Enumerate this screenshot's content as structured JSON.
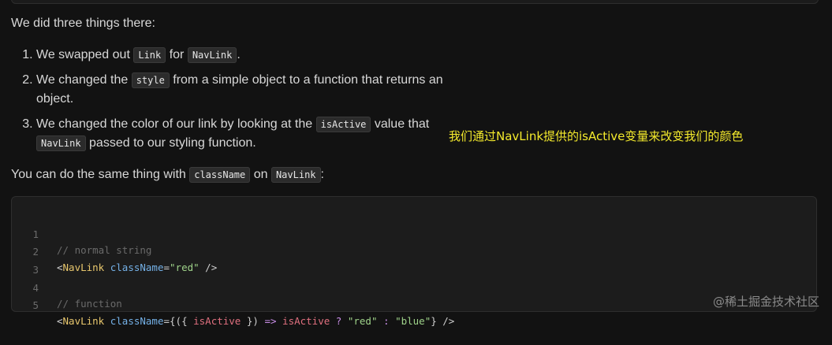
{
  "intro": "We did three things there:",
  "changes": [
    {
      "num": "1.",
      "before": "We swapped out ",
      "code1": "Link",
      "mid": " for ",
      "code2": "NavLink",
      "after": "."
    },
    {
      "num": "2.",
      "before": "We changed the ",
      "code1": "style",
      "after": " from a simple object to a function that returns an object."
    },
    {
      "num": "3.",
      "before": "We changed the color of our link by looking at the ",
      "code1": "isActive",
      "mid": " value that ",
      "code2": "NavLink",
      "after": " passed to our styling function."
    }
  ],
  "annotation": "我们通过NavLink提供的isActive变量来改变我们的颜色",
  "summary": {
    "before": "You can do the same thing with ",
    "code1": "className",
    "mid": " on ",
    "code2": "NavLink",
    "after": ":"
  },
  "code": {
    "lines": [
      {
        "n": "1",
        "comment": "// normal string"
      },
      {
        "n": "2",
        "open": "<",
        "tag": "NavLink",
        "attr": " className",
        "eq": "=",
        "str": "\"red\"",
        "close": " />"
      },
      {
        "n": "3"
      },
      {
        "n": "4",
        "comment": "// function"
      },
      {
        "n": "5",
        "open": "<",
        "tag": "NavLink",
        "attr": " className",
        "eq": "=",
        "p1": "{({ ",
        "var1": "isActive",
        "p2": " }) ",
        "arrow": "=>",
        "sp": " ",
        "var2": "isActive",
        "q": " ? ",
        "s1": "\"red\"",
        "colon": " : ",
        "s2": "\"blue\"",
        "p3": "}",
        "close": " />"
      }
    ]
  },
  "watermark": "@稀土掘金技术社区"
}
